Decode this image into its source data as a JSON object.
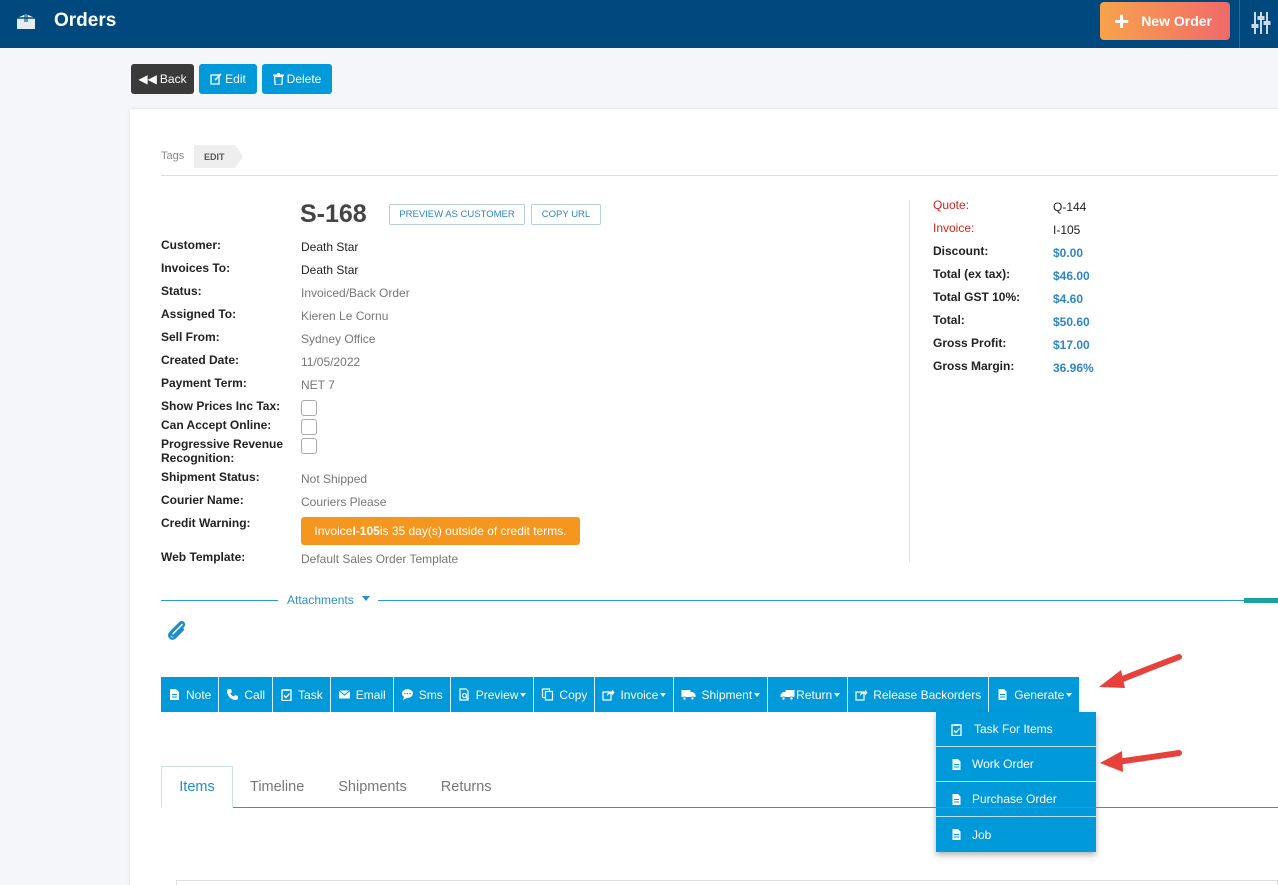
{
  "header": {
    "title": "Orders",
    "new_order_label": "New Order",
    "logo_icon": "box-icon",
    "settings_icon": "sliders-icon"
  },
  "actions": {
    "back": "Back",
    "edit": "Edit",
    "delete": "Delete"
  },
  "tags": {
    "label": "Tags",
    "chip": "EDIT"
  },
  "order": {
    "number": "S-168",
    "preview_as_customer": "PREVIEW AS CUSTOMER",
    "copy_url": "COPY URL",
    "fields": [
      {
        "label": "Customer:",
        "value": "Death Star"
      },
      {
        "label": "Invoices To:",
        "value": "Death Star"
      },
      {
        "label": "Status:",
        "value": "Invoiced/Back Order"
      },
      {
        "label": "Assigned To:",
        "value": "Kieren Le Cornu"
      },
      {
        "label": "Sell From:",
        "value": "Sydney Office"
      },
      {
        "label": "Created Date:",
        "value": "11/05/2022"
      },
      {
        "label": "Payment Term:",
        "value": "NET 7"
      }
    ],
    "checkboxes": [
      {
        "label": "Show Prices Inc Tax:"
      },
      {
        "label": "Can Accept Online:"
      },
      {
        "label_line1": "Progressive Revenue",
        "label_line2": "Recognition:"
      }
    ],
    "shipment_status": {
      "label": "Shipment Status:",
      "value": "Not Shipped"
    },
    "courier_name": {
      "label": "Courier Name:",
      "value": "Couriers Please"
    },
    "credit_warning": {
      "label": "Credit Warning:",
      "prefix": "Invoice ",
      "invoice": "I-105",
      "suffix": " is 35 day(s) outside of credit terms."
    },
    "web_template": {
      "label": "Web Template:",
      "value": "Default Sales Order Template"
    }
  },
  "summary": {
    "quote": {
      "label": "Quote:",
      "value": "Q-144"
    },
    "invoice": {
      "label": "Invoice:",
      "value": "I-105"
    },
    "discount": {
      "label": "Discount:",
      "value": "$0.00"
    },
    "total_ex_tax": {
      "label": "Total (ex tax):",
      "value": "$46.00"
    },
    "total_gst": {
      "label": "Total GST 10%:",
      "value": "$4.60"
    },
    "total": {
      "label": "Total:",
      "value": "$50.60"
    },
    "gross_profit": {
      "label": "Gross Profit:",
      "value": "$17.00"
    },
    "gross_margin": {
      "label": "Gross Margin:",
      "value": "36.96%"
    }
  },
  "attachments": {
    "label": "Attachments"
  },
  "toolbar": {
    "note": "Note",
    "call": "Call",
    "task": "Task",
    "email": "Email",
    "sms": "Sms",
    "preview": "Preview",
    "copy": "Copy",
    "invoice": "Invoice",
    "shipment": "Shipment",
    "return": "Return",
    "release_backorders": "Release Backorders",
    "generate": "Generate"
  },
  "generate_menu": {
    "task_for_items": "Task For Items",
    "work_order": "Work Order",
    "purchase_order": "Purchase Order",
    "job": "Job"
  },
  "tabs": {
    "items": "Items",
    "timeline": "Timeline",
    "shipments": "Shipments",
    "returns": "Returns"
  },
  "colors": {
    "header": "#00497f",
    "accent": "#0099d9",
    "warning": "#f5961e",
    "annotation_arrow": "#e8413b"
  }
}
